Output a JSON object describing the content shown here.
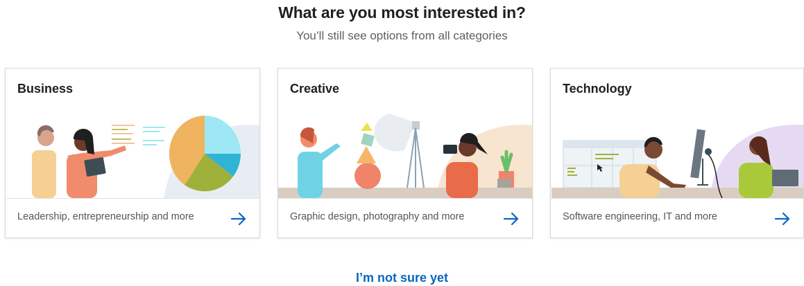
{
  "header": {
    "title": "What are you most interested in?",
    "subtitle": "You’ll still see options from all categories"
  },
  "cards": [
    {
      "title": "Business",
      "description": "Leadership, entrepreneurship and more",
      "illustration": "business-illustration"
    },
    {
      "title": "Creative",
      "description": "Graphic design, photography and more",
      "illustration": "creative-illustration"
    },
    {
      "title": "Technology",
      "description": "Software engineering, IT and more",
      "illustration": "technology-illustration"
    }
  ],
  "footer": {
    "not_sure_label": "I’m not sure yet"
  },
  "colors": {
    "accent": "#0a66c2",
    "title": "#1f1f1f",
    "muted": "#5f5f5f"
  }
}
